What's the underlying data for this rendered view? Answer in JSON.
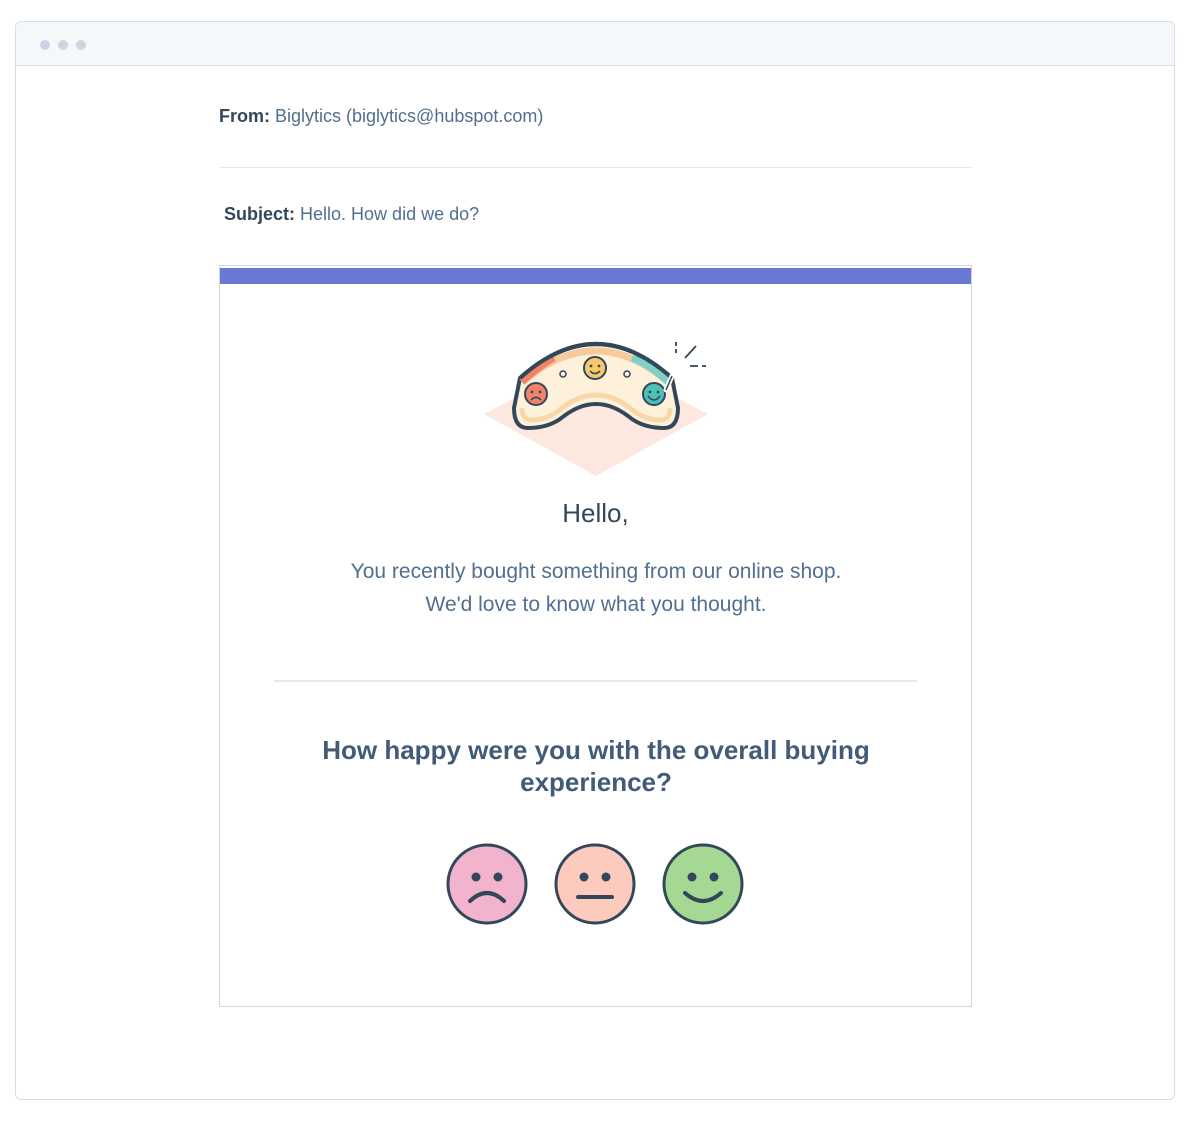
{
  "email": {
    "from_label": "From:",
    "from_value": "Biglytics (biglytics@hubspot.com)",
    "subject_label": "Subject:",
    "subject_value": "Hello. How did we do?"
  },
  "card": {
    "accent_color": "#6a78d1",
    "greeting": "Hello,",
    "intro": "You recently bought something from our online shop. We'd love to know what you thought.",
    "question": "How happy were you with the overall buying experience?",
    "ratings": [
      {
        "icon": "sad-face-icon",
        "color": "#f2b3cc"
      },
      {
        "icon": "neutral-face-icon",
        "color": "#fdcbbe"
      },
      {
        "icon": "happy-face-icon",
        "color": "#a5d993"
      }
    ]
  }
}
